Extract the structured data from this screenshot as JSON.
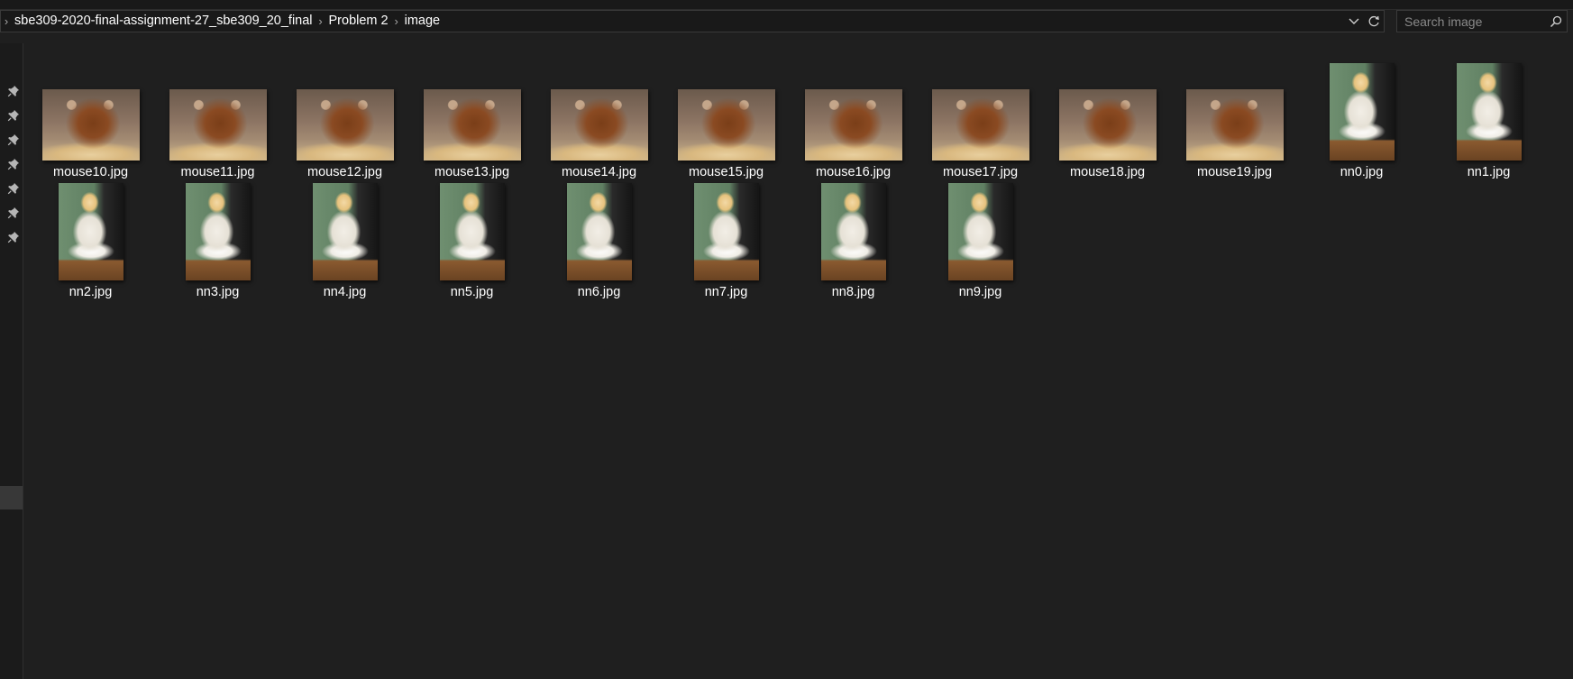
{
  "address_bar": {
    "breadcrumbs": [
      "sbe309-2020-final-assignment-27_sbe309_20_final",
      "Problem 2",
      "image"
    ]
  },
  "search": {
    "placeholder": "Search image"
  },
  "nav_pane": {
    "pinned_count": 7
  },
  "files": [
    {
      "name": "mouse10.jpg",
      "thumb": "mouse"
    },
    {
      "name": "mouse11.jpg",
      "thumb": "mouse"
    },
    {
      "name": "mouse12.jpg",
      "thumb": "mouse"
    },
    {
      "name": "mouse13.jpg",
      "thumb": "mouse"
    },
    {
      "name": "mouse14.jpg",
      "thumb": "mouse"
    },
    {
      "name": "mouse15.jpg",
      "thumb": "mouse"
    },
    {
      "name": "mouse16.jpg",
      "thumb": "mouse"
    },
    {
      "name": "mouse17.jpg",
      "thumb": "mouse"
    },
    {
      "name": "mouse18.jpg",
      "thumb": "mouse"
    },
    {
      "name": "mouse19.jpg",
      "thumb": "mouse"
    },
    {
      "name": "nn0.jpg",
      "thumb": "girl"
    },
    {
      "name": "nn1.jpg",
      "thumb": "girl"
    },
    {
      "name": "nn2.jpg",
      "thumb": "girl"
    },
    {
      "name": "nn3.jpg",
      "thumb": "girl"
    },
    {
      "name": "nn4.jpg",
      "thumb": "girl"
    },
    {
      "name": "nn5.jpg",
      "thumb": "girl"
    },
    {
      "name": "nn6.jpg",
      "thumb": "girl"
    },
    {
      "name": "nn7.jpg",
      "thumb": "girl"
    },
    {
      "name": "nn8.jpg",
      "thumb": "girl"
    },
    {
      "name": "nn9.jpg",
      "thumb": "girl"
    }
  ],
  "colors": {
    "background": "#1f1f1f",
    "chrome": "#191919",
    "text": "#ffffff",
    "muted": "#8a8a8a"
  }
}
